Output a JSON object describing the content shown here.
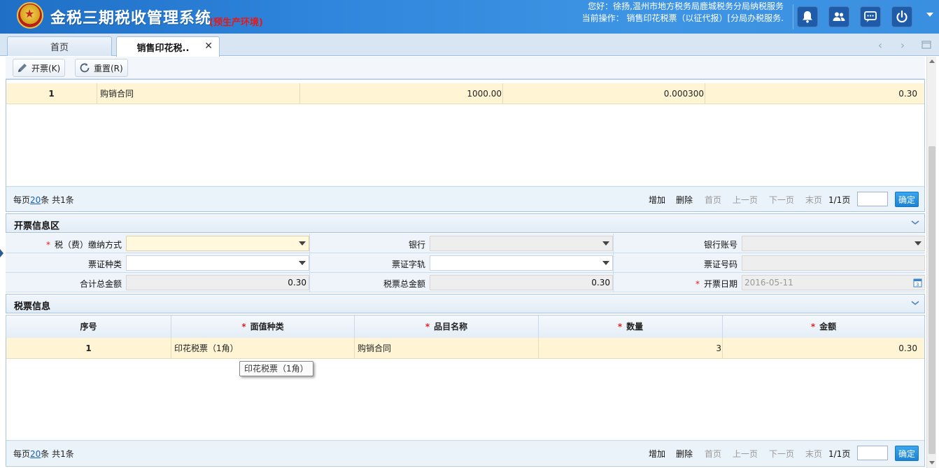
{
  "header": {
    "app_title": "金税三期税收管理系统",
    "env_tag": "(预生产环境)",
    "greeting": "您好：徐扬,温州市地方税务局鹿城税务分局纳税服务",
    "current_op": "当前操作：  销售印花税票（以征代报）[分局办税服务.",
    "buttons": [
      "bell-icon",
      "users-icon",
      "chat-icon",
      "power-icon"
    ]
  },
  "tabs": [
    {
      "label": "首页"
    },
    {
      "label": "销售印花税.."
    }
  ],
  "toolbar": {
    "issue_label": "开票(K)",
    "reset_label": "重置(R)"
  },
  "top_grid": {
    "row": {
      "seq": "1",
      "name": "购销合同",
      "amount": "1000.00",
      "rate": "0.000300",
      "tax": "0.30"
    },
    "pager": {
      "per_page_prefix": "每页",
      "per_page": "20",
      "per_page_suffix": "条 共1条",
      "add": "增加",
      "delete": "删除",
      "first": "首页",
      "prev": "上一页",
      "next": "下一页",
      "last": "末页",
      "page_info": "1/1页",
      "ok": "确定"
    }
  },
  "invoice_section": {
    "title": "开票信息区",
    "fields": {
      "pay_method_label": "税（费）缴纳方式",
      "bank_label": "银行",
      "bank_account_label": "银行账号",
      "voucher_type_label": "票证种类",
      "voucher_word_label": "票证字轨",
      "voucher_no_label": "票证号码",
      "total_label": "合计总金额",
      "total_value": "0.30",
      "ticket_total_label": "税票总金额",
      "ticket_total_value": "0.30",
      "date_label": "开票日期",
      "date_value": "2016-05-11"
    }
  },
  "ticket_section": {
    "title": "税票信息",
    "columns": [
      "序号",
      "面值种类",
      "品目名称",
      "数量",
      "金额"
    ],
    "row": {
      "seq": "1",
      "face": "印花税票（1角）",
      "item": "购销合同",
      "qty": "3",
      "amount": "0.30"
    },
    "tooltip": "印花税票（1角）",
    "pager": {
      "per_page_prefix": "每页",
      "per_page": "20",
      "per_page_suffix": "条 共1条",
      "add": "增加",
      "delete": "删除",
      "first": "首页",
      "prev": "上一页",
      "next": "下一页",
      "last": "末页",
      "page_info": "1/1页",
      "ok": "确定"
    }
  },
  "colors": {
    "accent": "#2f86dc",
    "required": "#e02020",
    "selected_row": "#fff5d5"
  }
}
